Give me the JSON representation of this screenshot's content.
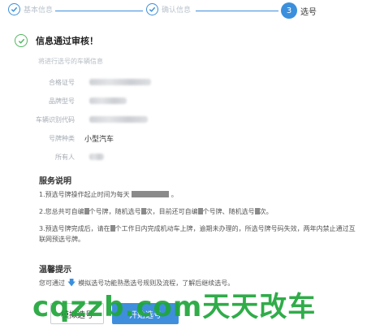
{
  "steps": [
    {
      "label": "基本信息",
      "state": "done"
    },
    {
      "label": "确认信息",
      "state": "done"
    },
    {
      "number": "3",
      "label": "选号",
      "state": "current"
    }
  ],
  "status": {
    "title": "信息通过审核！",
    "subtitle": "将进行选号的车辆信息"
  },
  "vehicle_info": [
    {
      "label": "合格证号",
      "value": ""
    },
    {
      "label": "品牌型号",
      "value": ""
    },
    {
      "label": "车辆识别代码",
      "value": ""
    },
    {
      "label": "号牌种类",
      "value": "小型汽车"
    },
    {
      "label": "所有人",
      "value": ""
    }
  ],
  "service": {
    "title": "服务说明",
    "item1": {
      "a": "1.预选号牌操作起止时间为每天",
      "b": "。"
    },
    "item2": {
      "a": "2.您总共可自编",
      "b": "个号牌，随机选号",
      "c": "次，目前还可自编",
      "d": "个号牌、随机选号",
      "e": "次。"
    },
    "item3": {
      "a": "3.预选号牌完成后，请在",
      "b": "个工作日内完成机动车上牌，逾期未办理的，所选号牌号码失效，两年内禁止通过互",
      "c": "联网预选号牌。"
    }
  },
  "tips": {
    "title": "温馨提示",
    "a": "您可通过",
    "b": "模拟选号功能熟悉选号规则及流程，了解后继续选号。"
  },
  "buttons": {
    "simulate": "模拟选号",
    "start": "开始选号"
  },
  "watermark": "cqzzb.com天天改车",
  "colors": {
    "accent": "#3b8fdc",
    "success": "#52b560",
    "watermark": "#1fa63a"
  },
  "icons": {
    "step_done": "check-icon",
    "status": "check-circle-icon",
    "tip_arrow": "arrow-down-icon"
  }
}
